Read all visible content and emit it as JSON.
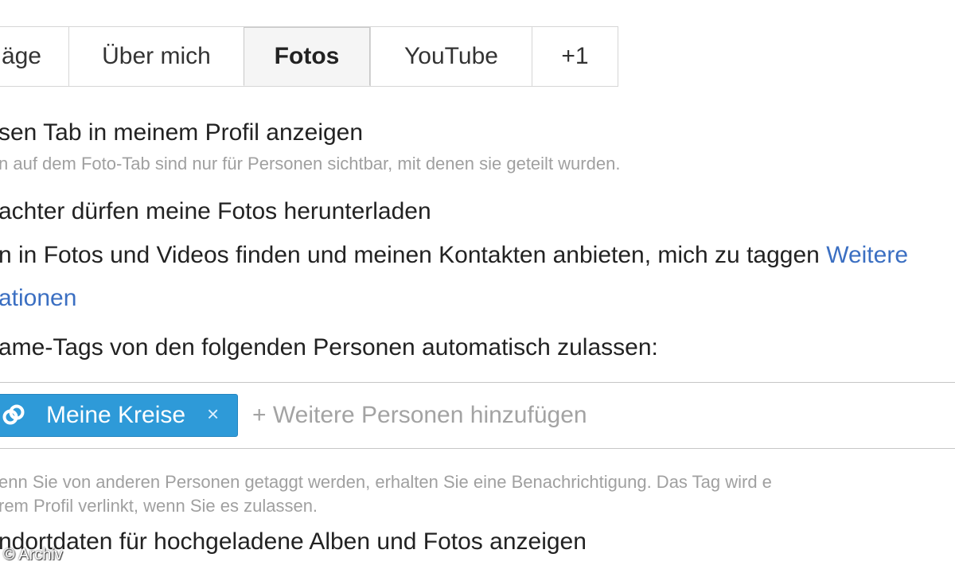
{
  "tabs": [
    {
      "label": "äge"
    },
    {
      "label": "Über mich"
    },
    {
      "label": "Fotos",
      "active": true
    },
    {
      "label": "YouTube"
    },
    {
      "label": "+1"
    }
  ],
  "settings": {
    "show_tab": {
      "label": "sen Tab in meinem Profil anzeigen",
      "hint": "n auf dem Foto-Tab sind nur für Personen sichtbar, mit denen sie geteilt wurden."
    },
    "allow_download": {
      "label": "achter dürfen meine Fotos herunterladen"
    },
    "find_me": {
      "label": "n in Fotos und Videos finden und meinen Kontakten anbieten, mich zu taggen",
      "link_part1": "Weitere",
      "link_part2": "ationen"
    },
    "auto_tags": {
      "label": "ame-Tags von den folgenden Personen automatisch zulassen:",
      "chip_label": "Meine Kreise",
      "chip_remove": "×",
      "add_placeholder": "+ Weitere Personen hinzufügen",
      "hint_line1": "enn Sie von anderen Personen getaggt werden, erhalten Sie eine Benachrichtigung. Das Tag wird e",
      "hint_line2": "rem Profil verlinkt, wenn Sie es zulassen."
    },
    "location": {
      "label": "ndortdaten für hochgeladene Alben und Fotos anzeigen"
    }
  },
  "watermark": "© Archiv",
  "colors": {
    "link": "#3b6fc2",
    "chip": "#2e9ad8",
    "hint": "#a0a0a0"
  },
  "icons": {
    "chip_icon": "circles-link-icon"
  }
}
